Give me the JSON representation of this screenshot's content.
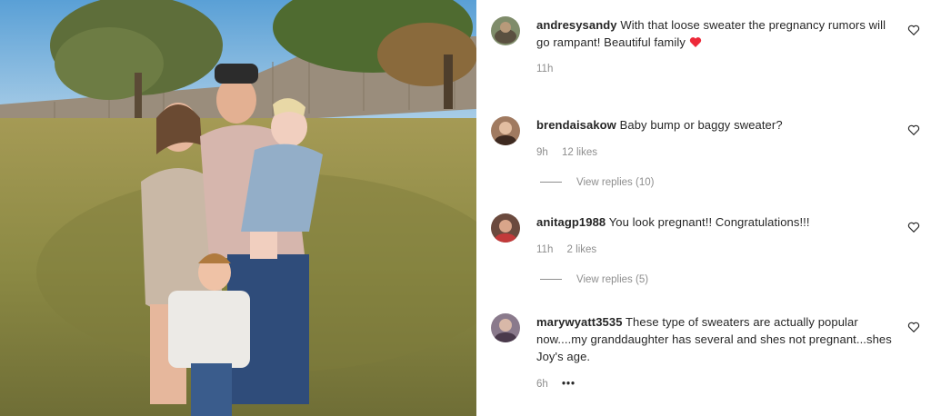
{
  "comments": [
    {
      "username": "andresysandy",
      "text": "With that loose sweater the pregnancy rumors will go rampant! Beautiful family",
      "emoji": "red-heart",
      "time": "11h",
      "likes": "",
      "replies": ""
    },
    {
      "username": "brendaisakow",
      "text": "Baby bump or baggy sweater?",
      "time": "9h",
      "likes": "12 likes",
      "replies": "View replies (10)"
    },
    {
      "username": "anitagp1988",
      "text": "You look pregnant!! Congratulations!!!",
      "time": "11h",
      "likes": "2 likes",
      "replies": "View replies (5)"
    },
    {
      "username": "marywyatt3535",
      "text": "These type of sweaters are actually popular now....my granddaughter has several and shes not pregnant...shes Joy's age.",
      "time": "6h",
      "more": "•••"
    }
  ],
  "icons": {
    "like": "heart-outline-icon",
    "emoji_color": "#ed2939"
  }
}
